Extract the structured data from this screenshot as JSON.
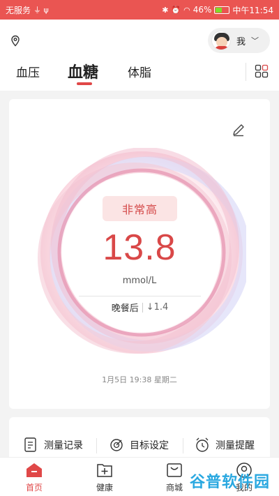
{
  "status": {
    "carrier": "无服务",
    "battery": "46%",
    "time": "中午11:54",
    "colors": {
      "bar": "#ea5552"
    }
  },
  "header": {
    "location_icon": "location-pin-icon",
    "user_label": "我",
    "tabs": [
      {
        "label": "血压",
        "active": false
      },
      {
        "label": "血糖",
        "active": true
      },
      {
        "label": "体脂",
        "active": false
      }
    ],
    "grid_icon": "apps-grid-icon"
  },
  "reading": {
    "level": "非常高",
    "value": "13.8",
    "unit": "mmol/L",
    "period": "晚餐后",
    "delta": "↓1.4",
    "timestamp": "1月5日 19:38 星期二",
    "accent": "#d94848"
  },
  "quick_actions": [
    {
      "label": "测量记录",
      "icon": "record-list-icon"
    },
    {
      "label": "目标设定",
      "icon": "target-icon"
    },
    {
      "label": "测量提醒",
      "icon": "alarm-clock-icon"
    }
  ],
  "bottom_nav": [
    {
      "label": "首页",
      "icon": "home-icon",
      "active": true
    },
    {
      "label": "健康",
      "icon": "health-plus-icon",
      "active": false
    },
    {
      "label": "商城",
      "icon": "shop-bag-icon",
      "active": false
    },
    {
      "label": "我的",
      "icon": "profile-icon",
      "active": false
    }
  ],
  "watermark": "谷普软件园"
}
